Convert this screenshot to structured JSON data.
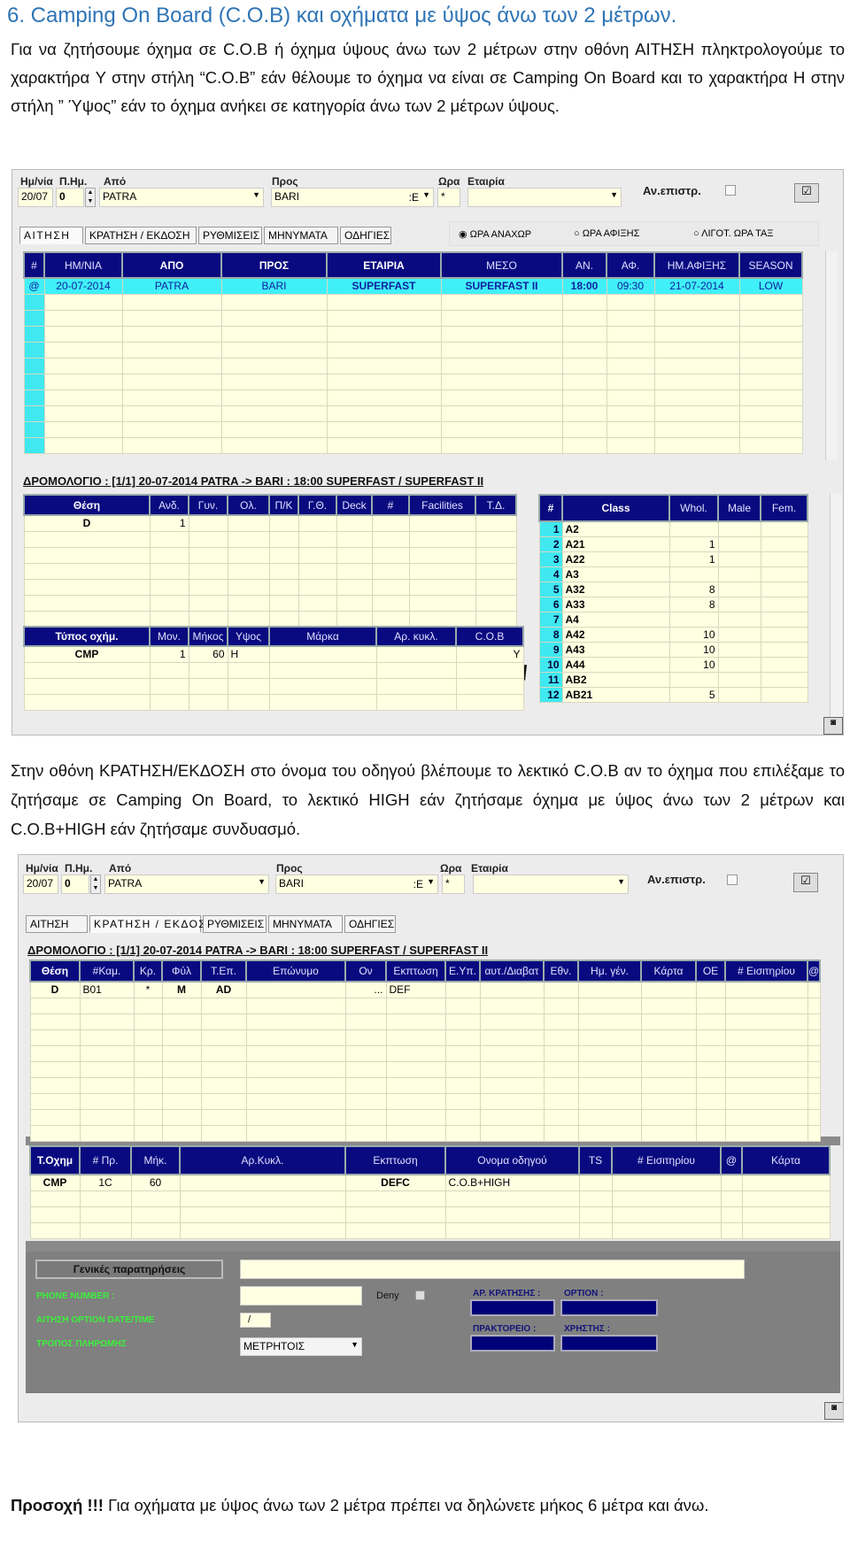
{
  "heading": "6.  Camping On Board (C.O.B) και οχήματα με ύψος άνω των 2 μέτρων.",
  "intro": "Για να ζητήσουμε όχημα σε  C.O.B ή όχημα ύψους άνω των 2 μέτρων στην οθόνη ΑΙΤΗΣΗ πληκτρολογούμε το χαρακτήρα Y στην στήλη “C.O.B” εάν θέλουμε το όχημα να είναι σε Camping On Board και το χαρακτήρα H στην στήλη ” Ύψος”  εάν το  όχημα ανήκει  σε κατηγορία άνω των 2 μέτρων ύψους.",
  "middle_text": "Στην οθόνη ΚΡΑΤΗΣΗ/ΕΚΔΟΣΗ στο όνομα του οδηγού βλέπουμε το λεκτικό C.O.B αν το όχημα που επιλέξαμε το ζητήσαμε σε Camping On Board, το λεκτικό HIGH  εάν ζητήσαμε όχημα με ύψος άνω των 2 μέτρων και C.O.B+HIGH εάν ζητήσαμε συνδυασμό.",
  "warning": {
    "bold": "Προσοχή !!!",
    "text": " Για οχήματα με ύψος άνω των 2 μέτρα πρέπει να δηλώνετε μήκος  6 μέτρα  και άνω."
  },
  "form": {
    "date_label": "Ημ/νία",
    "pday_label": "Π.Ημ.",
    "from_label": "Από",
    "to_label": "Προς",
    "time_label": "Ωρα",
    "company_label": "Εταιρία",
    "date": "20/07",
    "pday": "0",
    "from": "PATRA",
    "to": "BARI",
    "to_suffix": ":E",
    "time": "*",
    "company": "",
    "return_label": "Αν.επιστρ."
  },
  "tabs": [
    "ΑΙΤΗΣΗ",
    "ΚΡΑΤΗΣΗ / ΕΚΔΟΣΗ",
    "ΡΥΘΜΙΣΕΙΣ",
    "ΜΗΝΥΜΑΤΑ",
    "ΟΔΗΓΙΕΣ"
  ],
  "radios": [
    "ΩΡΑ ΑΝΑΧΩΡ",
    "ΩΡΑ ΑΦΙΞΗΣ",
    "ΛΙΓΟΤ. ΩΡΑ ΤΑΞ"
  ],
  "route": "ΔΡΟΜΟΛΟΓΙΟ : [1/1]  20-07-2014   PATRA -> BARI : 18:00   SUPERFAST  /  SUPERFAST II",
  "colors": {
    "header": "#0a0a80",
    "cell": "#ffffe1",
    "selected_row": "#40f0f8",
    "panel": "#808080",
    "green_label": "#3cf03c",
    "heading": "#2e74b5"
  },
  "screen1": {
    "trips": {
      "columns": [
        "#",
        "ΗΜ/ΝΙΑ",
        "ΑΠΟ",
        "ΠΡΟΣ",
        "ΕΤΑΙΡΙΑ",
        "ΜΕΣΟ",
        "ΑΝ.",
        "ΑΦ.",
        "ΗΜ.ΑΦΙΞΗΣ",
        "SEASON"
      ],
      "rows": [
        [
          "@",
          "20-07-2014",
          "PATRA",
          "BARI",
          "SUPERFAST",
          "SUPERFAST II",
          "18:00",
          "09:30",
          "21-07-2014",
          "LOW"
        ]
      ]
    },
    "passengers": {
      "columns": [
        "Θέση",
        "Ανδ.",
        "Γυν.",
        "Ολ.",
        "Π/Κ",
        "Γ.Θ.",
        "Deck",
        "#",
        "Facilities",
        "Τ.Δ."
      ],
      "rows": [
        [
          "D",
          "1",
          "",
          "",
          "",
          "",
          "",
          "",
          "",
          ""
        ]
      ]
    },
    "vehicles": {
      "columns": [
        "Τύπος οχήμ.",
        "Μον.",
        "Μήκος",
        "Υψος",
        "Μάρκα",
        "Αρ. κυκλ.",
        "C.O.B"
      ],
      "rows": [
        [
          "CMP",
          "1",
          "60",
          "H",
          "",
          "",
          "Y"
        ]
      ]
    },
    "classes": {
      "columns": [
        "#",
        "Class",
        "Whol.",
        "Male",
        "Fem."
      ],
      "rows": [
        [
          "1",
          "A2",
          "",
          "",
          ""
        ],
        [
          "2",
          "A21",
          "1",
          "",
          ""
        ],
        [
          "3",
          "A22",
          "1",
          "",
          ""
        ],
        [
          "4",
          "A3",
          "",
          "",
          ""
        ],
        [
          "5",
          "A32",
          "8",
          "",
          ""
        ],
        [
          "6",
          "A33",
          "8",
          "",
          ""
        ],
        [
          "7",
          "A4",
          "",
          "",
          ""
        ],
        [
          "8",
          "A42",
          "10",
          "",
          ""
        ],
        [
          "9",
          "A43",
          "10",
          "",
          ""
        ],
        [
          "10",
          "A44",
          "10",
          "",
          ""
        ],
        [
          "11",
          "AB2",
          "",
          "",
          ""
        ],
        [
          "12",
          "AB21",
          "5",
          "",
          ""
        ]
      ]
    }
  },
  "screen2": {
    "passengers": {
      "columns": [
        "Θέση",
        "#Καμ.",
        "Κρ.",
        "Φύλ",
        "Τ.Επ.",
        "Επώνυμο",
        "Ον",
        "Εκπτωση",
        "Ε.Υπ.",
        "αυτ./Διαβατ",
        "Εθν.",
        "Ημ. γέν.",
        "Κάρτα",
        "ΟΕ",
        "# Εισιτηρίου",
        "@"
      ],
      "rows": [
        [
          "D",
          "B01",
          "*",
          "M",
          "AD",
          "",
          "...",
          "DEF",
          "",
          "",
          "",
          "",
          "",
          "",
          "",
          ""
        ]
      ]
    },
    "vehicles": {
      "columns": [
        "Τ.Οχημ",
        "# Πρ.",
        "Μήκ.",
        "Αρ.Κυκλ.",
        "Εκπτωση",
        "Ονομα οδηγού",
        "TS",
        "# Εισιτηρίου",
        "@",
        "Κάρτα"
      ],
      "rows": [
        [
          "CMP",
          "1C",
          "60",
          "",
          "DEFC",
          "C.O.B+HIGH",
          "",
          "",
          "",
          ""
        ]
      ]
    },
    "panel": {
      "remarks_label": "Γενικές παρατηρήσεις",
      "phone_label": "PHONE NUMBER :",
      "deny_label": "Deny",
      "option_date_label": "ΑΙΤΗΣΗ OPTION DATE/TIME",
      "option_date_value": "/",
      "payment_label": "ΤΡΟΠΟΣ ΠΛΗΡΩΜΗΣ",
      "payment_value": "ΜΕΤΡΗΤΟΙΣ",
      "booking_no_label": "ΑΡ. ΚΡΑΤΗΣΗΣ :",
      "option_label": "OPTION :",
      "agency_label": "ΠΡΑΚΤΟΡΕΙΟ :",
      "user_label": "ΧΡΗΣΤΗΣ :"
    }
  }
}
